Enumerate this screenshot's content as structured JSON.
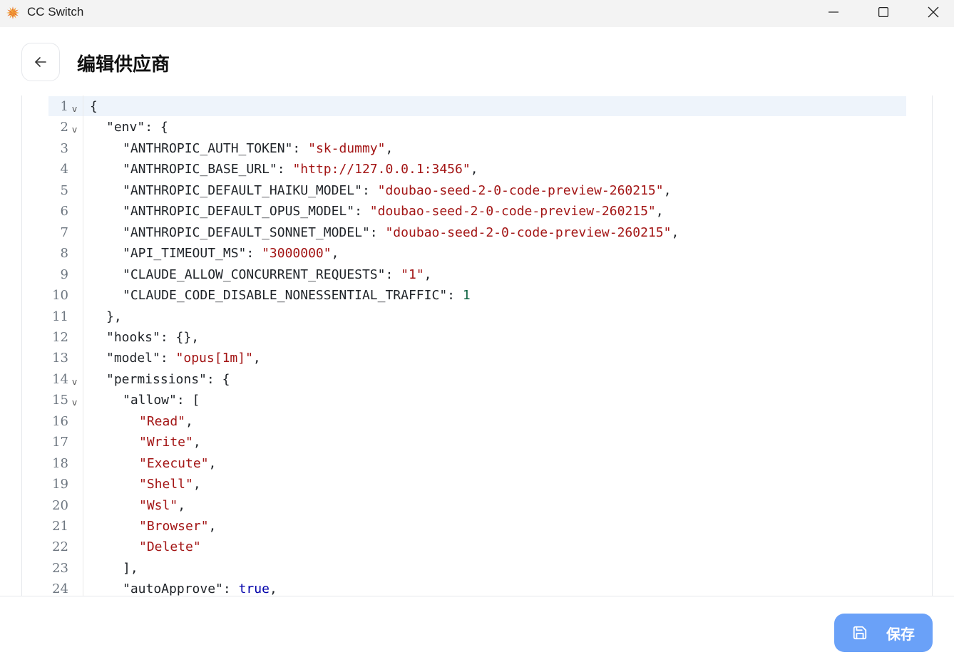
{
  "window": {
    "title": "CC Switch"
  },
  "header": {
    "title": "编辑供应商"
  },
  "footer": {
    "save_label": "保存"
  },
  "editor": {
    "lines": [
      {
        "n": "1",
        "fold": true,
        "indent": 0,
        "tokens": [
          {
            "t": "punc",
            "v": "{"
          }
        ]
      },
      {
        "n": "2",
        "fold": true,
        "indent": 1,
        "tokens": [
          {
            "t": "key",
            "v": "\"env\""
          },
          {
            "t": "punc",
            "v": ": {"
          }
        ]
      },
      {
        "n": "3",
        "fold": false,
        "indent": 2,
        "tokens": [
          {
            "t": "key",
            "v": "\"ANTHROPIC_AUTH_TOKEN\""
          },
          {
            "t": "punc",
            "v": ": "
          },
          {
            "t": "str",
            "v": "\"sk-dummy\""
          },
          {
            "t": "punc",
            "v": ","
          }
        ]
      },
      {
        "n": "4",
        "fold": false,
        "indent": 2,
        "tokens": [
          {
            "t": "key",
            "v": "\"ANTHROPIC_BASE_URL\""
          },
          {
            "t": "punc",
            "v": ": "
          },
          {
            "t": "str",
            "v": "\"http://127.0.0.1:3456\""
          },
          {
            "t": "punc",
            "v": ","
          }
        ]
      },
      {
        "n": "5",
        "fold": false,
        "indent": 2,
        "tokens": [
          {
            "t": "key",
            "v": "\"ANTHROPIC_DEFAULT_HAIKU_MODEL\""
          },
          {
            "t": "punc",
            "v": ": "
          },
          {
            "t": "str",
            "v": "\"doubao-seed-2-0-code-preview-260215\""
          },
          {
            "t": "punc",
            "v": ","
          }
        ]
      },
      {
        "n": "6",
        "fold": false,
        "indent": 2,
        "tokens": [
          {
            "t": "key",
            "v": "\"ANTHROPIC_DEFAULT_OPUS_MODEL\""
          },
          {
            "t": "punc",
            "v": ": "
          },
          {
            "t": "str",
            "v": "\"doubao-seed-2-0-code-preview-260215\""
          },
          {
            "t": "punc",
            "v": ","
          }
        ]
      },
      {
        "n": "7",
        "fold": false,
        "indent": 2,
        "tokens": [
          {
            "t": "key",
            "v": "\"ANTHROPIC_DEFAULT_SONNET_MODEL\""
          },
          {
            "t": "punc",
            "v": ": "
          },
          {
            "t": "str",
            "v": "\"doubao-seed-2-0-code-preview-260215\""
          },
          {
            "t": "punc",
            "v": ","
          }
        ]
      },
      {
        "n": "8",
        "fold": false,
        "indent": 2,
        "tokens": [
          {
            "t": "key",
            "v": "\"API_TIMEOUT_MS\""
          },
          {
            "t": "punc",
            "v": ": "
          },
          {
            "t": "str",
            "v": "\"3000000\""
          },
          {
            "t": "punc",
            "v": ","
          }
        ]
      },
      {
        "n": "9",
        "fold": false,
        "indent": 2,
        "tokens": [
          {
            "t": "key",
            "v": "\"CLAUDE_ALLOW_CONCURRENT_REQUESTS\""
          },
          {
            "t": "punc",
            "v": ": "
          },
          {
            "t": "str",
            "v": "\"1\""
          },
          {
            "t": "punc",
            "v": ","
          }
        ]
      },
      {
        "n": "10",
        "fold": false,
        "indent": 2,
        "tokens": [
          {
            "t": "key",
            "v": "\"CLAUDE_CODE_DISABLE_NONESSENTIAL_TRAFFIC\""
          },
          {
            "t": "punc",
            "v": ": "
          },
          {
            "t": "num",
            "v": "1"
          }
        ]
      },
      {
        "n": "11",
        "fold": false,
        "indent": 1,
        "tokens": [
          {
            "t": "punc",
            "v": "},"
          }
        ]
      },
      {
        "n": "12",
        "fold": false,
        "indent": 1,
        "tokens": [
          {
            "t": "key",
            "v": "\"hooks\""
          },
          {
            "t": "punc",
            "v": ": {},"
          }
        ]
      },
      {
        "n": "13",
        "fold": false,
        "indent": 1,
        "tokens": [
          {
            "t": "key",
            "v": "\"model\""
          },
          {
            "t": "punc",
            "v": ": "
          },
          {
            "t": "str",
            "v": "\"opus[1m]\""
          },
          {
            "t": "punc",
            "v": ","
          }
        ]
      },
      {
        "n": "14",
        "fold": true,
        "indent": 1,
        "tokens": [
          {
            "t": "key",
            "v": "\"permissions\""
          },
          {
            "t": "punc",
            "v": ": {"
          }
        ]
      },
      {
        "n": "15",
        "fold": true,
        "indent": 2,
        "tokens": [
          {
            "t": "key",
            "v": "\"allow\""
          },
          {
            "t": "punc",
            "v": ": ["
          }
        ]
      },
      {
        "n": "16",
        "fold": false,
        "indent": 3,
        "tokens": [
          {
            "t": "str",
            "v": "\"Read\""
          },
          {
            "t": "punc",
            "v": ","
          }
        ]
      },
      {
        "n": "17",
        "fold": false,
        "indent": 3,
        "tokens": [
          {
            "t": "str",
            "v": "\"Write\""
          },
          {
            "t": "punc",
            "v": ","
          }
        ]
      },
      {
        "n": "18",
        "fold": false,
        "indent": 3,
        "tokens": [
          {
            "t": "str",
            "v": "\"Execute\""
          },
          {
            "t": "punc",
            "v": ","
          }
        ]
      },
      {
        "n": "19",
        "fold": false,
        "indent": 3,
        "tokens": [
          {
            "t": "str",
            "v": "\"Shell\""
          },
          {
            "t": "punc",
            "v": ","
          }
        ]
      },
      {
        "n": "20",
        "fold": false,
        "indent": 3,
        "tokens": [
          {
            "t": "str",
            "v": "\"Wsl\""
          },
          {
            "t": "punc",
            "v": ","
          }
        ]
      },
      {
        "n": "21",
        "fold": false,
        "indent": 3,
        "tokens": [
          {
            "t": "str",
            "v": "\"Browser\""
          },
          {
            "t": "punc",
            "v": ","
          }
        ]
      },
      {
        "n": "22",
        "fold": false,
        "indent": 3,
        "tokens": [
          {
            "t": "str",
            "v": "\"Delete\""
          }
        ]
      },
      {
        "n": "23",
        "fold": false,
        "indent": 2,
        "tokens": [
          {
            "t": "punc",
            "v": "],"
          }
        ]
      },
      {
        "n": "24",
        "fold": false,
        "indent": 2,
        "tokens": [
          {
            "t": "key",
            "v": "\"autoApprove\""
          },
          {
            "t": "punc",
            "v": ": "
          },
          {
            "t": "bool",
            "v": "true"
          },
          {
            "t": "punc",
            "v": ","
          }
        ]
      }
    ]
  }
}
